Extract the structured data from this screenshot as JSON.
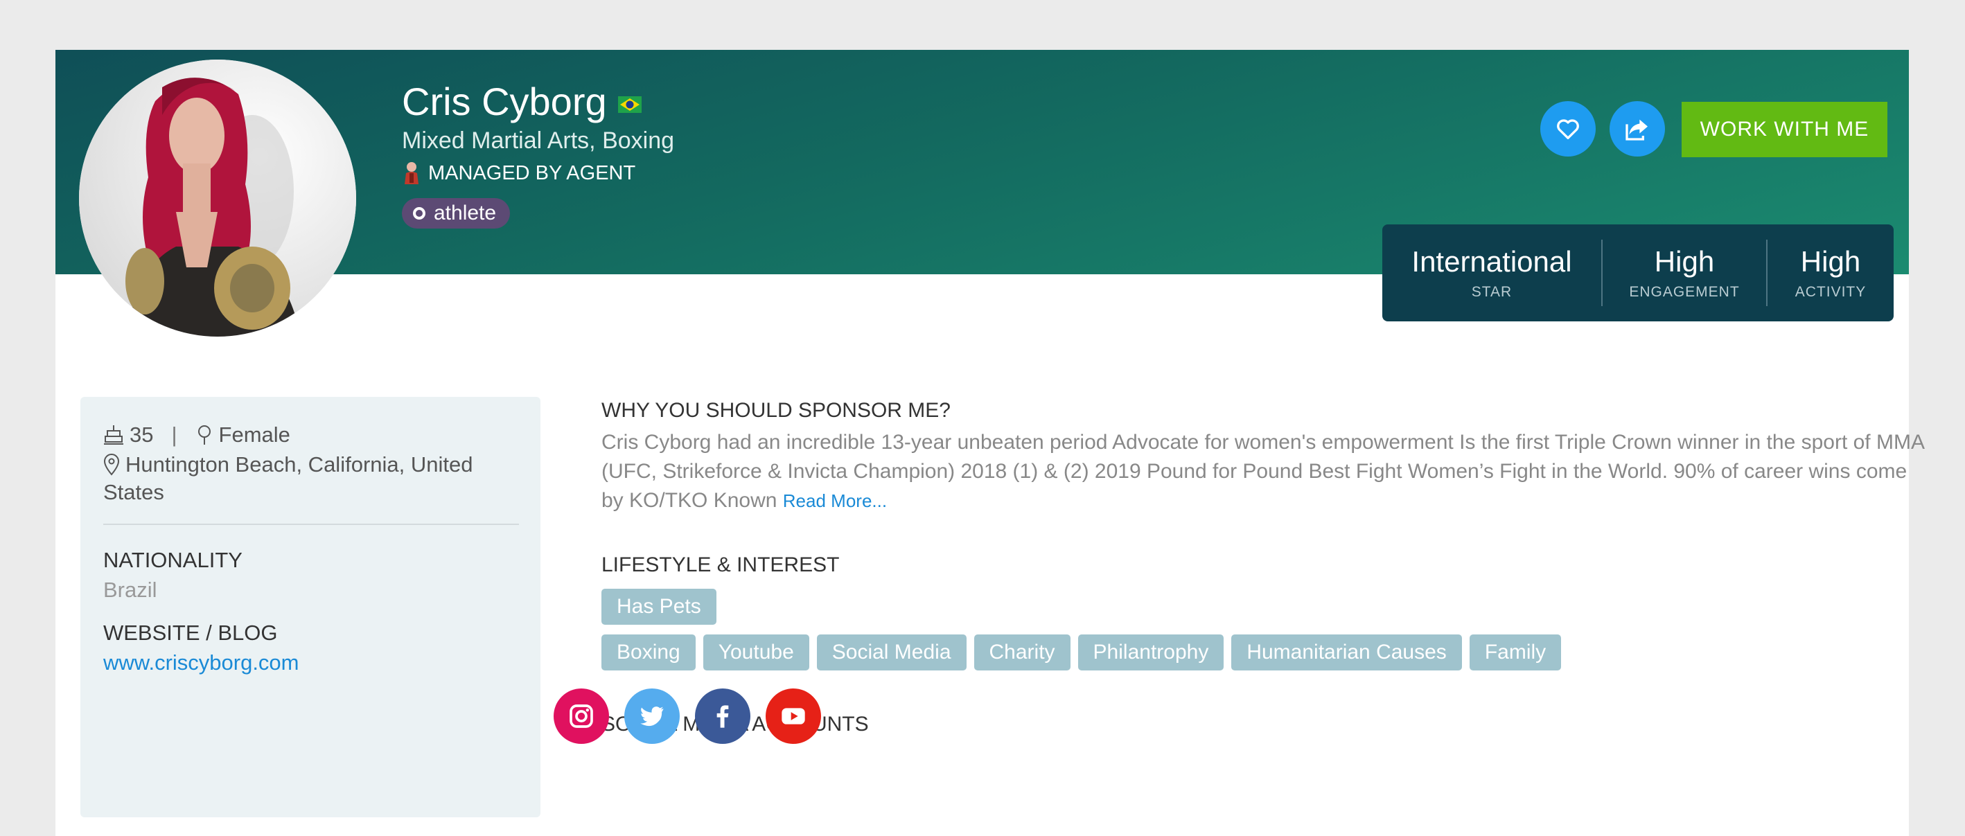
{
  "profile": {
    "name": "Cris Cyborg",
    "flag_icon": "brazil-flag-icon",
    "sport": "Mixed Martial Arts, Boxing",
    "managed": "MANAGED BY AGENT",
    "tag": "athlete"
  },
  "actions": {
    "favorite_icon": "heart-icon",
    "share_icon": "share-icon",
    "work_label": "WORK WITH ME"
  },
  "stats": [
    {
      "value": "International",
      "label": "STAR"
    },
    {
      "value": "High",
      "label": "ENGAGEMENT"
    },
    {
      "value": "High",
      "label": "ACTIVITY"
    }
  ],
  "details": {
    "age": "35",
    "separator": "|",
    "gender": "Female",
    "location_line1": "Huntington Beach,  California,  United",
    "location_line2": "States",
    "nationality_label": "NATIONALITY",
    "nationality": "Brazil",
    "website_label": "WEBSITE / BLOG",
    "website": "www.criscyborg.com"
  },
  "sponsor": {
    "heading": "WHY YOU SHOULD SPONSOR ME?",
    "text": "Cris Cyborg had an incredible 13-year unbeaten period Advocate for women's empowerment Is the first Triple Crown winner in the sport of MMA (UFC, Strikeforce & Invicta Champion) 2018 (1) & (2) 2019 Pound for Pound Best Fight Women’s Fight in the World. 90% of career wins come by KO/TKO Known",
    "read_more": "Read More..."
  },
  "lifestyle": {
    "heading": "LIFESTYLE & INTEREST",
    "row1": [
      "Has Pets"
    ],
    "row2": [
      "Boxing",
      "Youtube",
      "Social Media",
      "Charity",
      "Philantrophy",
      "Humanitarian Causes",
      "Family"
    ]
  },
  "social": {
    "heading": "SOCIAL MEDIA ACCOUNTS",
    "accounts": [
      {
        "icon": "instagram-icon",
        "color": "#e0115f"
      },
      {
        "icon": "twitter-icon",
        "color": "#55acee"
      },
      {
        "icon": "facebook-icon",
        "color": "#3b5998"
      },
      {
        "icon": "youtube-icon",
        "color": "#e62117"
      }
    ]
  },
  "colors": {
    "banner": "#13695f",
    "stats_bg": "#0d3e4d",
    "accent_green": "#62ba13",
    "accent_blue": "#1e9cf0",
    "chip": "#9fc3cd",
    "tag": "#5c4a74",
    "link": "#1a8ad6"
  }
}
